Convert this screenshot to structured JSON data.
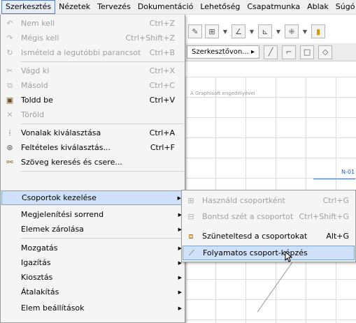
{
  "menubar": [
    "Szerkesztés",
    "Nézetek",
    "Tervezés",
    "Dokumentáció",
    "Lehetőség",
    "Csapatmunka",
    "Ablak",
    "Súgó"
  ],
  "toolbar": {
    "view_dropdown": "Szerkesztővon..."
  },
  "canvas": {
    "note": "A Graphisoft engedélyével",
    "label": "N-01"
  },
  "menu_items": [
    {
      "label": "Nem kell",
      "shortcut": "Ctrl+Z",
      "icon": "undo-icon",
      "disabled": true
    },
    {
      "label": "Mégis kell",
      "shortcut": "Ctrl+Shift+Z",
      "icon": "redo-icon",
      "disabled": true
    },
    {
      "label": "Ismételd a legutóbbi parancsot",
      "shortcut": "Ctrl+B",
      "icon": "repeat-icon",
      "disabled": true
    },
    {
      "label": "Vágd ki",
      "shortcut": "Ctrl+X",
      "icon": "scissors-icon",
      "disabled": true
    },
    {
      "label": "Másold",
      "shortcut": "Ctrl+C",
      "icon": "copy-icon",
      "disabled": true
    },
    {
      "label": "Toldd be",
      "shortcut": "Ctrl+V",
      "icon": "paste-icon",
      "disabled": false
    },
    {
      "label": "Töröld",
      "shortcut": "",
      "icon": "delete-icon",
      "disabled": true
    },
    {
      "label": "Vonalak kiválasztása",
      "shortcut": "Ctrl+A",
      "icon": "select-lines-icon",
      "disabled": false
    },
    {
      "label": "Feltételes kiválasztás...",
      "shortcut": "Ctrl+F",
      "icon": "conditional-select-icon",
      "disabled": false
    },
    {
      "label": "Szöveg keresés és csere...",
      "shortcut": "",
      "icon": "binoculars-icon",
      "disabled": false
    },
    {
      "label": "Csoportok kezelése",
      "shortcut": "",
      "icon": "",
      "submenu": true,
      "highlighted": true
    },
    {
      "label": "Megjelenítési sorrend",
      "shortcut": "",
      "icon": "",
      "submenu": true
    },
    {
      "label": "Elemek zárolása",
      "shortcut": "",
      "icon": "",
      "submenu": true
    },
    {
      "label": "Mozgatás",
      "shortcut": "",
      "icon": "",
      "submenu": true
    },
    {
      "label": "Igazítás",
      "shortcut": "",
      "icon": "",
      "submenu": true
    },
    {
      "label": "Kiosztás",
      "shortcut": "",
      "icon": "",
      "submenu": true
    },
    {
      "label": "Átalakítás",
      "shortcut": "",
      "icon": "",
      "submenu": true
    },
    {
      "label": "Elem beállítások",
      "shortcut": "",
      "icon": "",
      "submenu": true
    }
  ],
  "submenu_items": [
    {
      "label": "Használd csoportként",
      "shortcut": "Ctrl+G",
      "icon": "group-icon",
      "disabled": true
    },
    {
      "label": "Bontsd szét a csoportot",
      "shortcut": "Ctrl+Shift+G",
      "icon": "ungroup-icon",
      "disabled": true
    },
    {
      "label": "Szüneteltesd a csoportokat",
      "shortcut": "Alt+G",
      "icon": "suspend-groups-icon",
      "disabled": false
    },
    {
      "label": "Folyamatos csoport-képzés",
      "shortcut": "",
      "icon": "autogroup-icon",
      "disabled": false,
      "highlighted": true
    }
  ]
}
